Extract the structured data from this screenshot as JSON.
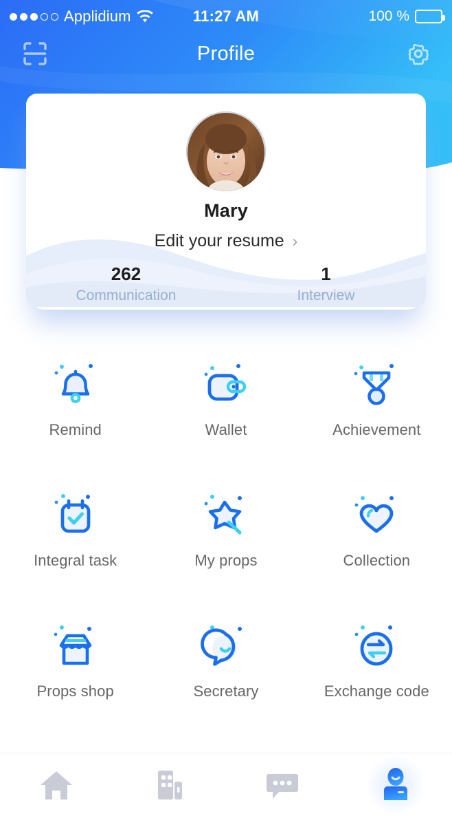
{
  "statusbar": {
    "carrier": "Applidium",
    "signal_filled": 3,
    "signal_empty": 2,
    "wifi_icon": "wifi-icon",
    "time": "11:27 AM",
    "battery_percent": "100 %",
    "battery_level": 100
  },
  "navbar": {
    "title": "Profile",
    "left_icon": "scan-icon",
    "right_icon": "gear-icon"
  },
  "profile": {
    "avatar_alt": "Mary",
    "name": "Mary",
    "edit_resume_label": "Edit your resume",
    "chevron": "›",
    "stats": [
      {
        "value": "262",
        "label": "Communication"
      },
      {
        "value": "1",
        "label": "Interview"
      }
    ]
  },
  "grid": {
    "items": [
      {
        "label": "Remind",
        "icon": "bell-icon"
      },
      {
        "label": "Wallet",
        "icon": "wallet-icon"
      },
      {
        "label": "Achievement",
        "icon": "medal-icon"
      },
      {
        "label": "Integral task",
        "icon": "calendar-check-icon"
      },
      {
        "label": "My props",
        "icon": "magic-wand-star-icon"
      },
      {
        "label": "Collection",
        "icon": "heart-icon"
      },
      {
        "label": "Props shop",
        "icon": "storefront-icon"
      },
      {
        "label": "Secretary",
        "icon": "chat-smile-icon"
      },
      {
        "label": "Exchange code",
        "icon": "exchange-circle-icon"
      }
    ]
  },
  "tabbar": {
    "tabs": [
      {
        "name": "home",
        "icon": "home-icon",
        "active": false
      },
      {
        "name": "company",
        "icon": "building-icon",
        "active": false
      },
      {
        "name": "message",
        "icon": "chat-dots-icon",
        "active": false
      },
      {
        "name": "profile",
        "icon": "person-icon",
        "active": true
      }
    ]
  },
  "colors": {
    "header_blue": "#2C6CF6",
    "header_cyan": "#35BEF8",
    "icon_blue": "#1A6FEE",
    "icon_cyan": "#3ED0F0",
    "label_gray": "#666668",
    "stat_label": "#97aece",
    "tab_inactive": "#c9ccd6"
  }
}
